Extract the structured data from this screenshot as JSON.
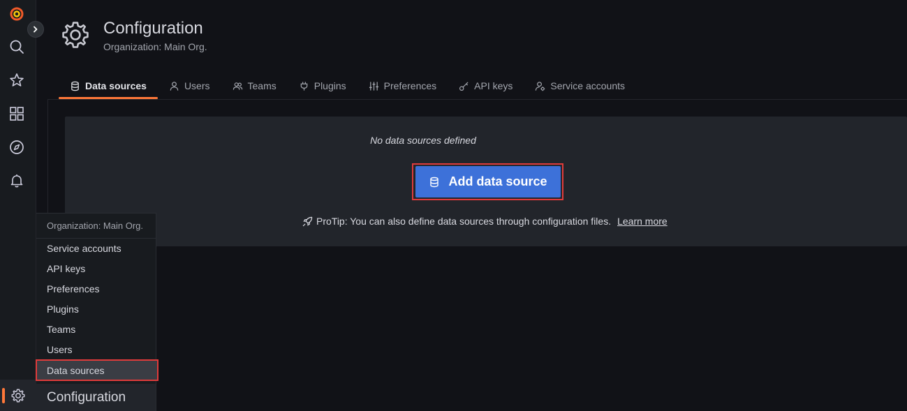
{
  "colors": {
    "accent": "#ff7839",
    "primary_button": "#3d71d9",
    "highlight_outline": "#e03b3b",
    "background": "#111217",
    "panel": "#22252b"
  },
  "sidebar": {
    "items": [
      {
        "icon": "grafana-logo-icon"
      },
      {
        "icon": "search-icon"
      },
      {
        "icon": "star-icon"
      },
      {
        "icon": "dashboards-icon"
      },
      {
        "icon": "compass-icon"
      },
      {
        "icon": "bell-icon"
      },
      {
        "icon": "gear-icon"
      }
    ]
  },
  "header": {
    "title": "Configuration",
    "subtitle": "Organization: Main Org."
  },
  "tabs": [
    {
      "label": "Data sources",
      "icon": "database-icon",
      "active": true
    },
    {
      "label": "Users",
      "icon": "user-icon",
      "active": false
    },
    {
      "label": "Teams",
      "icon": "users-icon",
      "active": false
    },
    {
      "label": "Plugins",
      "icon": "plug-icon",
      "active": false
    },
    {
      "label": "Preferences",
      "icon": "sliders-icon",
      "active": false
    },
    {
      "label": "API keys",
      "icon": "key-icon",
      "active": false
    },
    {
      "label": "Service accounts",
      "icon": "user-cog-icon",
      "active": false
    }
  ],
  "main": {
    "empty_text": "No data sources defined",
    "add_button_label": "Add data source",
    "protip_text": "ProTip: You can also define data sources through configuration files.",
    "protip_link": "Learn more"
  },
  "flyout": {
    "header": "Organization: Main Org.",
    "items": [
      {
        "label": "Service accounts"
      },
      {
        "label": "API keys"
      },
      {
        "label": "Preferences"
      },
      {
        "label": "Plugins"
      },
      {
        "label": "Teams"
      },
      {
        "label": "Users"
      },
      {
        "label": "Data sources",
        "selected": true
      }
    ],
    "footer": "Configuration"
  }
}
